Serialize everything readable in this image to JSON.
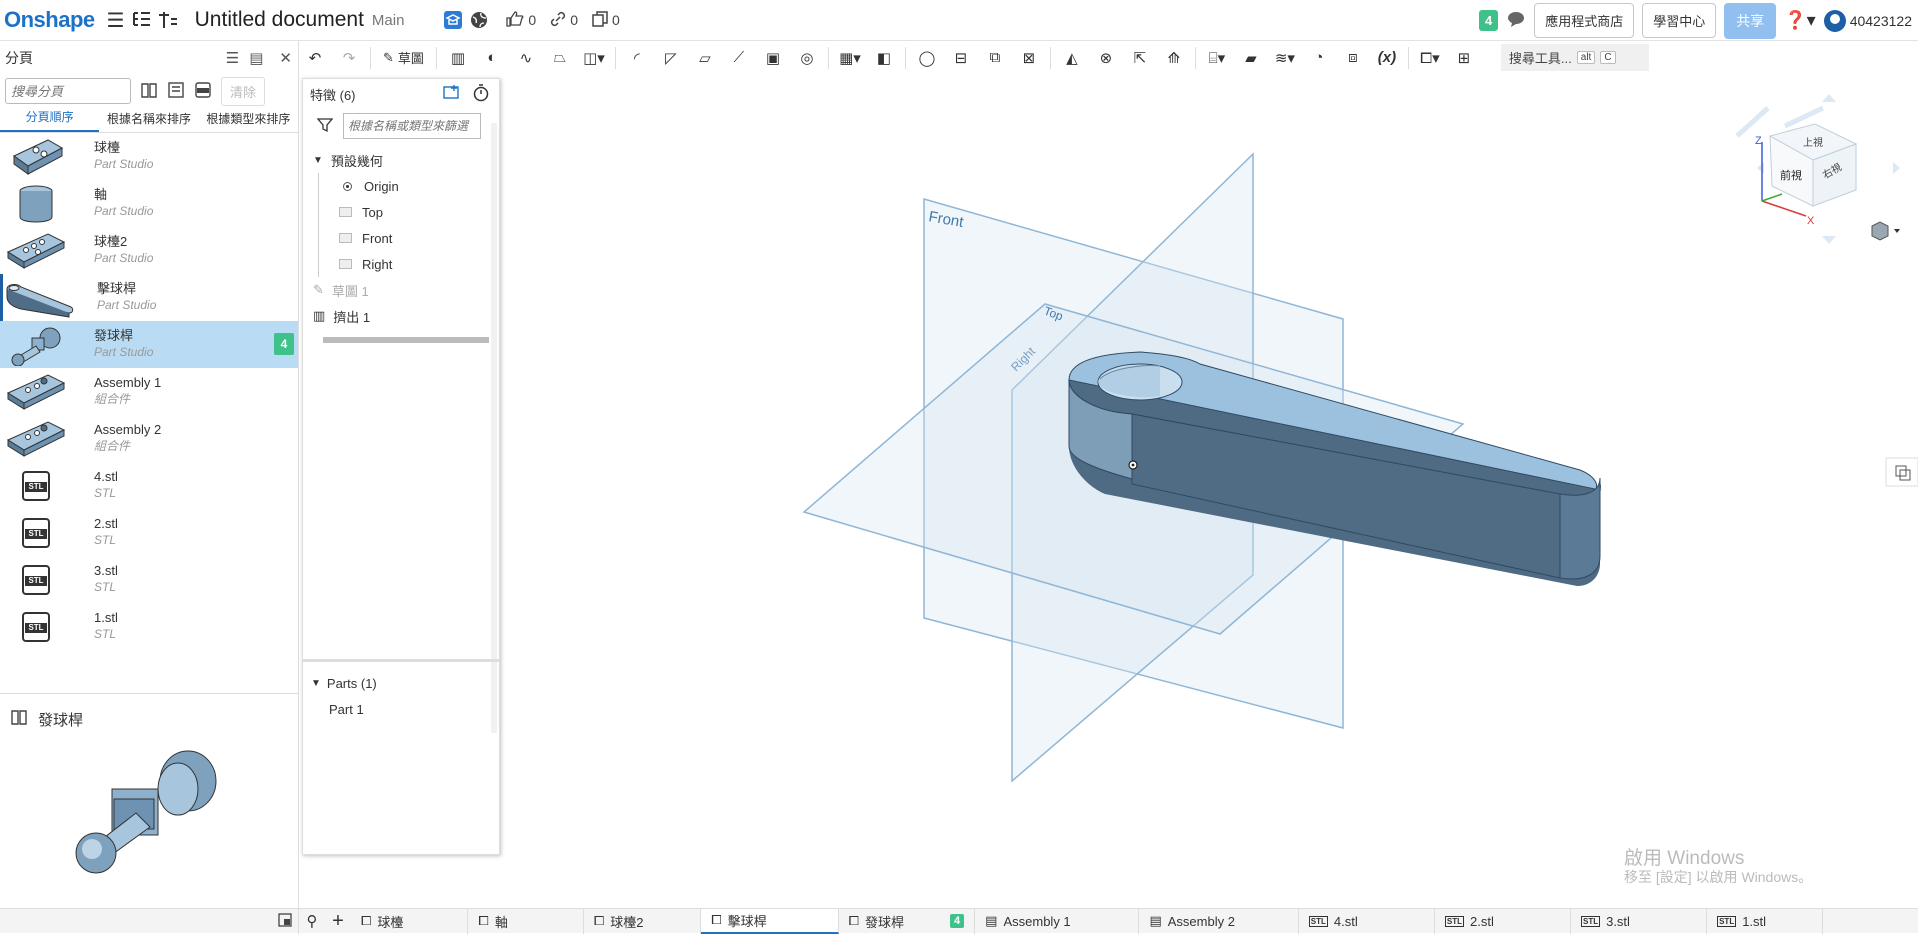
{
  "topbar": {
    "logo": "Onshape",
    "doc_title": "Untitled document",
    "workspace": "Main",
    "likes": "0",
    "links": "0",
    "copies": "0",
    "notif_count": "4",
    "app_store": "應用程式商店",
    "learning_center": "學習中心",
    "share": "共享",
    "user": "40423122"
  },
  "left": {
    "header": "分頁",
    "search_placeholder": "搜尋分頁",
    "clear": "清除",
    "sort_tabs": [
      "分頁順序",
      "根據名稱來排序",
      "根據類型來排序"
    ],
    "tabs": [
      {
        "name": "球檯",
        "type": "Part Studio"
      },
      {
        "name": "軸",
        "type": "Part Studio"
      },
      {
        "name": "球檯2",
        "type": "Part Studio"
      },
      {
        "name": "擊球桿",
        "type": "Part Studio"
      },
      {
        "name": "發球桿",
        "type": "Part Studio",
        "badge": "4"
      },
      {
        "name": "Assembly 1",
        "type": "組合件"
      },
      {
        "name": "Assembly 2",
        "type": "組合件"
      },
      {
        "name": "4.stl",
        "type": "STL"
      },
      {
        "name": "2.stl",
        "type": "STL"
      },
      {
        "name": "3.stl",
        "type": "STL"
      },
      {
        "name": "1.stl",
        "type": "STL"
      }
    ],
    "preview_title": "發球桿",
    "stl_label": "STL"
  },
  "toolbar": {
    "sketch": "草圖",
    "search_tools": "搜尋工具...",
    "shortcut_alt": "alt",
    "shortcut_c": "C"
  },
  "features": {
    "header": "特徵 (6)",
    "filter_placeholder": "根據名稱或類型來篩選",
    "default_geometry": "預設幾何",
    "origin": "Origin",
    "top": "Top",
    "front": "Front",
    "right": "Right",
    "sketch1": "草圖 1",
    "extrude1": "擠出 1",
    "parts_header": "Parts (1)",
    "part1": "Part 1"
  },
  "viewport": {
    "plane_front": "Front",
    "plane_top": "Top",
    "plane_right": "Right",
    "cube_top": "上視",
    "cube_front": "前視",
    "cube_right": "右視",
    "axis_x": "X",
    "axis_z": "Z",
    "win1": "啟用 Windows",
    "win2": "移至 [設定] 以啟用 Windows。"
  },
  "bottom_tabs": [
    {
      "name": "球檯"
    },
    {
      "name": "軸"
    },
    {
      "name": "球檯2"
    },
    {
      "name": "擊球桿",
      "active": true
    },
    {
      "name": "發球桿",
      "badge": "4"
    },
    {
      "name": "Assembly 1"
    },
    {
      "name": "Assembly 2"
    },
    {
      "name": "4.stl"
    },
    {
      "name": "2.stl"
    },
    {
      "name": "3.stl"
    },
    {
      "name": "1.stl"
    }
  ],
  "colors": {
    "brand": "#1d72c7",
    "badge": "#3fc28a",
    "part_fill": "#6a8eab",
    "plane": "#8fb6d6"
  }
}
